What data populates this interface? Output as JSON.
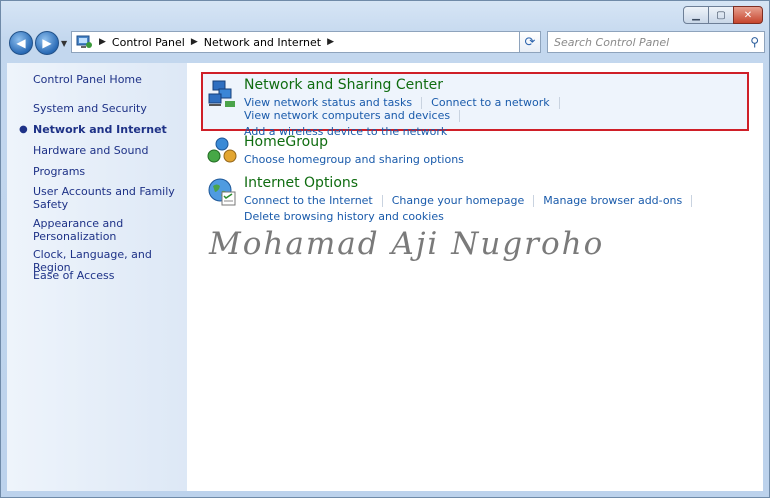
{
  "window": {
    "controls": {
      "minimize": "▁",
      "maximize": "▢",
      "close": "✕"
    }
  },
  "navigation": {
    "back_icon": "arrow-left-icon",
    "forward_icon": "arrow-right-icon",
    "breadcrumbs": [
      "Control Panel",
      "Network and Internet"
    ],
    "search_placeholder": "Search Control Panel"
  },
  "sidebar": {
    "home": "Control Panel Home",
    "items": [
      "System and Security",
      "Network and Internet",
      "Hardware and Sound",
      "Programs",
      "User Accounts and Family Safety",
      "Appearance and Personalization",
      "Clock, Language, and Region",
      "Ease of Access"
    ],
    "selected_index": 1
  },
  "sections": [
    {
      "title": "Network and Sharing Center",
      "links": [
        "View network status and tasks",
        "Connect to a network",
        "View network computers and devices",
        "Add a wireless device to the network"
      ],
      "icon": "network-icon",
      "highlighted": true
    },
    {
      "title": "HomeGroup",
      "links": [
        "Choose homegroup and sharing options"
      ],
      "icon": "homegroup-icon"
    },
    {
      "title": "Internet Options",
      "links": [
        "Connect to the Internet",
        "Change your homepage",
        "Manage browser add-ons",
        "Delete browsing history and cookies"
      ],
      "icon": "internet-options-icon"
    }
  ],
  "watermark": "Mohamad Aji Nugroho",
  "colors": {
    "highlight_border": "#cf1f28",
    "section_title": "#0f6c10",
    "link": "#1a5bab",
    "sidebar_link": "#1e3287"
  }
}
